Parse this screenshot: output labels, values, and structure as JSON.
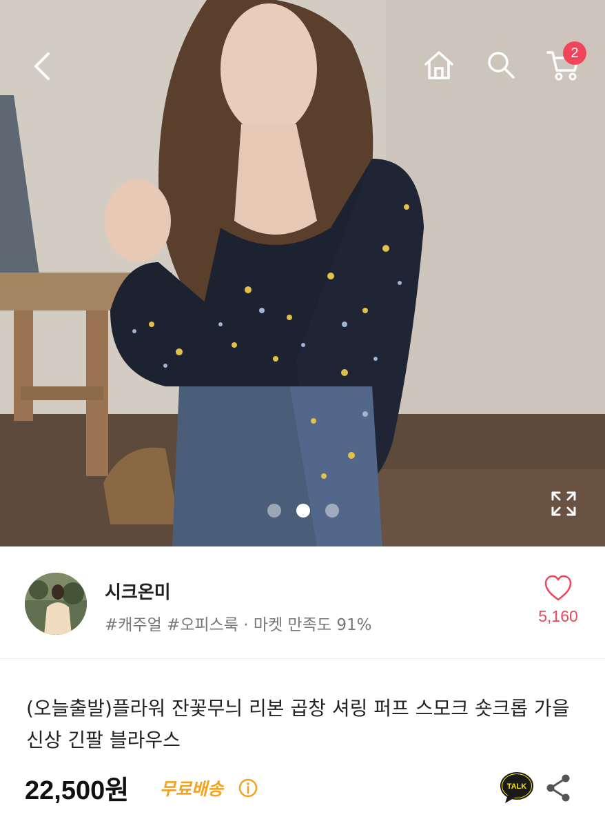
{
  "header": {
    "cart_badge_count": "2",
    "icons": [
      "back-icon",
      "home-icon",
      "search-icon",
      "cart-icon",
      "expand-icon"
    ]
  },
  "gallery": {
    "total_images": 3,
    "active_index": 1
  },
  "seller": {
    "name": "시크온미",
    "tags": "#캐주얼 #오피스룩 · 마켓 만족도 91%",
    "like_count": "5,160"
  },
  "product": {
    "title": "(오늘출발)플라워 잔꽃무늬 리본 곱창 셔링 퍼프 스모크 숏크롭 가을 신상 긴팔 블라우스",
    "price": "22,500원",
    "shipping": "무료배송",
    "talk_label": "TALK"
  },
  "colors": {
    "accent": "#f0455b",
    "shipping": "#f3a21e",
    "talk_yellow": "#fee500"
  }
}
